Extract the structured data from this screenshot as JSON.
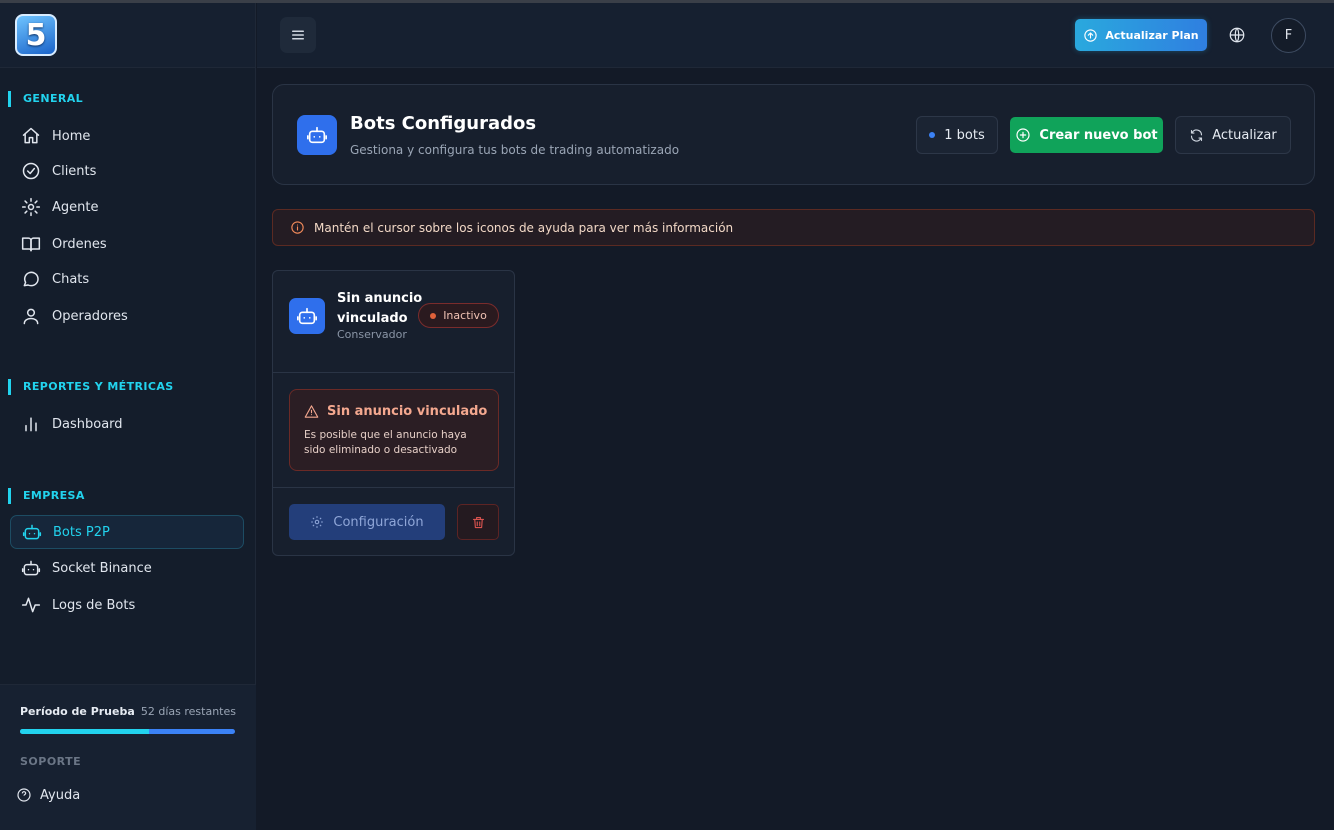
{
  "app": {
    "logo_text": "5"
  },
  "sidebar": {
    "sections": [
      {
        "title": "GENERAL",
        "items": [
          {
            "label": "Home",
            "icon": "home-icon"
          },
          {
            "label": "Clients",
            "icon": "check-circle-icon"
          },
          {
            "label": "Agente",
            "icon": "gear-icon"
          },
          {
            "label": "Ordenes",
            "icon": "book-open-icon"
          },
          {
            "label": "Chats",
            "icon": "chat-bubble-icon"
          },
          {
            "label": "Operadores",
            "icon": "user-icon"
          }
        ]
      },
      {
        "title": "REPORTES Y MÉTRICAS",
        "items": [
          {
            "label": "Dashboard",
            "icon": "bar-chart-icon"
          }
        ]
      },
      {
        "title": "EMPRESA",
        "items": [
          {
            "label": "Bots P2P",
            "icon": "bot-icon",
            "active": true
          },
          {
            "label": "Socket Binance",
            "icon": "bot-icon"
          },
          {
            "label": "Logs de Bots",
            "icon": "activity-icon"
          }
        ]
      }
    ],
    "trial": {
      "label": "Período de Prueba",
      "days": "52 días restantes",
      "progress": 0.6
    },
    "support_title": "SOPORTE",
    "help_label": "Ayuda"
  },
  "topbar": {
    "upgrade_label": "Actualizar Plan",
    "avatar_initial": "F"
  },
  "header": {
    "title": "Bots Configurados",
    "subtitle": "Gestiona y configura tus bots de trading automatizado",
    "count_label": "1 bots",
    "create_label": "Crear nuevo bot",
    "refresh_label": "Actualizar"
  },
  "info_banner": {
    "text": "Mantén el cursor sobre los iconos de ayuda para ver más información"
  },
  "bots": [
    {
      "name": "Sin anuncio vinculado",
      "strategy": "Conservador",
      "status": "Inactivo",
      "warning_title": "Sin anuncio vinculado",
      "warning_text": "Es posible que el anuncio haya sido eliminado o desactivado",
      "config_label": "Configuración"
    }
  ],
  "colors": {
    "accent": "#22d3ee",
    "primary": "#2f6fec",
    "success": "#10a35a",
    "danger": "#d9534f",
    "background": "#131a27"
  }
}
